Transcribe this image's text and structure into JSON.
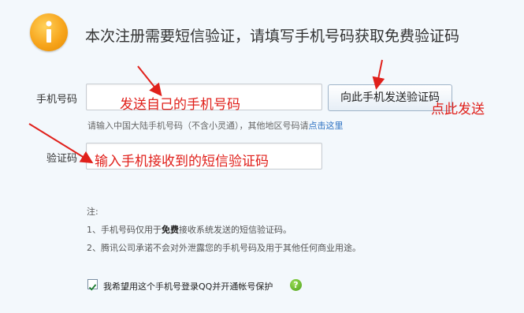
{
  "header": {
    "icon": "info-icon",
    "title": "本次注册需要短信验证，请填写手机号码获取免费验证码"
  },
  "form": {
    "phone_label": "手机号码",
    "send_button": "向此手机发送验证码",
    "hint_text": "请输入中国大陆手机号码（不含小灵通），其他地区号码请",
    "hint_link": "点击这里",
    "code_label": "验证码"
  },
  "annotations": {
    "phone_anno": "发送自己的手机号码",
    "button_anno": "点此发送",
    "code_anno": "输入手机接收到的短信验证码",
    "color": "#e0201b"
  },
  "notes": {
    "title": "注:",
    "item1_prefix": "1、手机号码仅用于",
    "item1_bold": "免费",
    "item1_suffix": "接收系统发送的短信验证码。",
    "item2": "2、腾讯公司承诺不会对外泄露您的手机号码及用于其他任何商业用途。"
  },
  "protect": {
    "checked": true,
    "label": "我希望用这个手机号登录QQ并开通帐号保护",
    "help_icon": "help-icon",
    "help_glyph": "?"
  },
  "colors": {
    "background": "#f3f8fc",
    "link": "#2a6fc1",
    "icon": "#f7a51c"
  }
}
